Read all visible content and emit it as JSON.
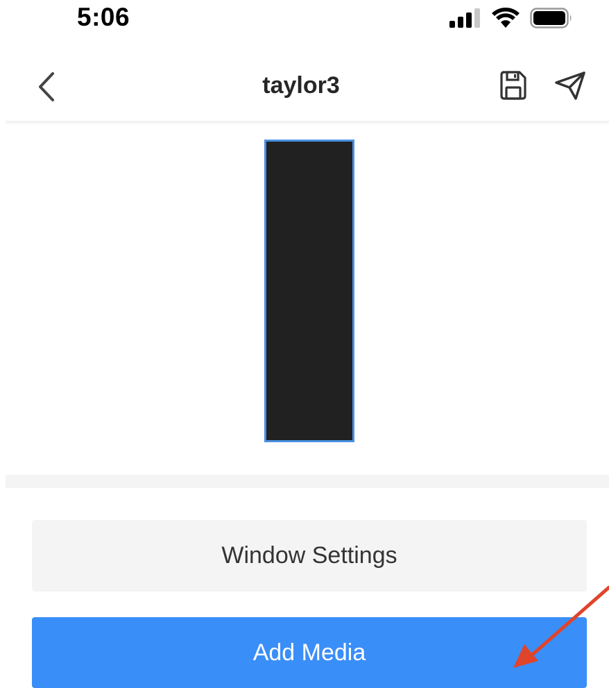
{
  "status_bar": {
    "time": "5:06",
    "icons": [
      "cellular-signal-icon",
      "wifi-icon",
      "battery-icon"
    ]
  },
  "header": {
    "title": "taylor3",
    "back_icon": "chevron-left-icon",
    "actions": [
      "save-icon",
      "send-icon"
    ]
  },
  "preview": {
    "window_fill": "#212121",
    "selection_color": "#4a90e2"
  },
  "buttons": {
    "window_settings_label": "Window Settings",
    "add_media_label": "Add Media"
  },
  "colors": {
    "accent": "#3a8ef8",
    "secondary_button": "#f4f4f4",
    "annotation_arrow": "#e0442b"
  }
}
